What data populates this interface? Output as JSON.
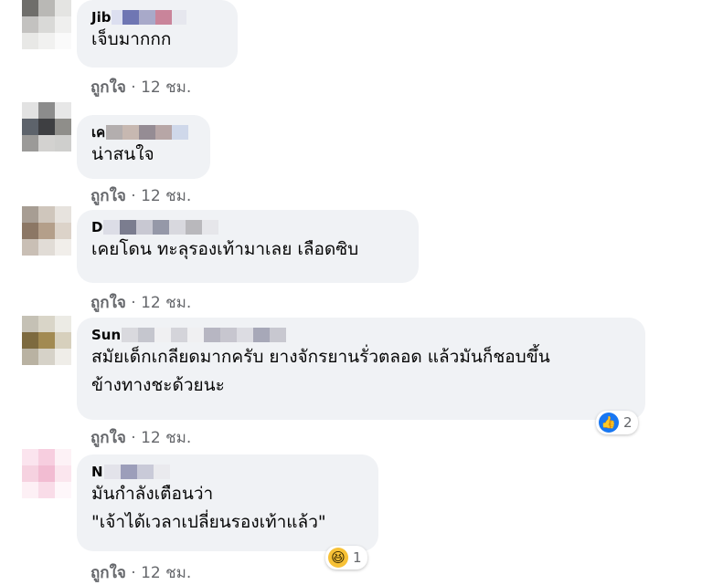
{
  "comments": [
    {
      "author": "Jib",
      "text_lines": [
        "เจ็บมากกก"
      ],
      "actions": {
        "like": "ถูกใจ",
        "sep": "·",
        "time": "12 ชม."
      }
    },
    {
      "author": "เค",
      "text_lines": [
        "น่าสนใจ"
      ],
      "actions": {
        "like": "ถูกใจ",
        "sep": "·",
        "time": "12 ชม."
      }
    },
    {
      "author": "D",
      "text_lines": [
        "เคยโดน ทะลุรองเท้ามาเลย เลือดซิบ"
      ],
      "actions": {
        "like": "ถูกใจ",
        "sep": "·",
        "time": "12 ชม."
      }
    },
    {
      "author": "Sun",
      "text_lines": [
        "สมัยเด็กเกลียดมากครับ ยางจักรยานรั่วตลอด แล้วมันก็ชอบขึ้น",
        "ข้างทางชะด้วยนะ"
      ],
      "actions": {
        "like": "ถูกใจ",
        "sep": "·",
        "time": "12 ชม."
      },
      "reaction": {
        "icon": "like-icon",
        "count": "2"
      }
    },
    {
      "author": "N",
      "text_lines": [
        "มันกำลังเตือนว่า",
        "\"เจ้าได้เวลาเปลี่ยนรองเท้าแล้ว\""
      ],
      "actions": {
        "like": "ถูกใจ",
        "sep": "·",
        "time": "12 ชม."
      },
      "reaction": {
        "icon": "haha-icon",
        "count": "1"
      }
    }
  ],
  "colors": {
    "bubble": "#f0f2f5",
    "meta_text": "#65676b",
    "like_blue": "#1877f2",
    "haha_yellow": "#f7c136"
  }
}
